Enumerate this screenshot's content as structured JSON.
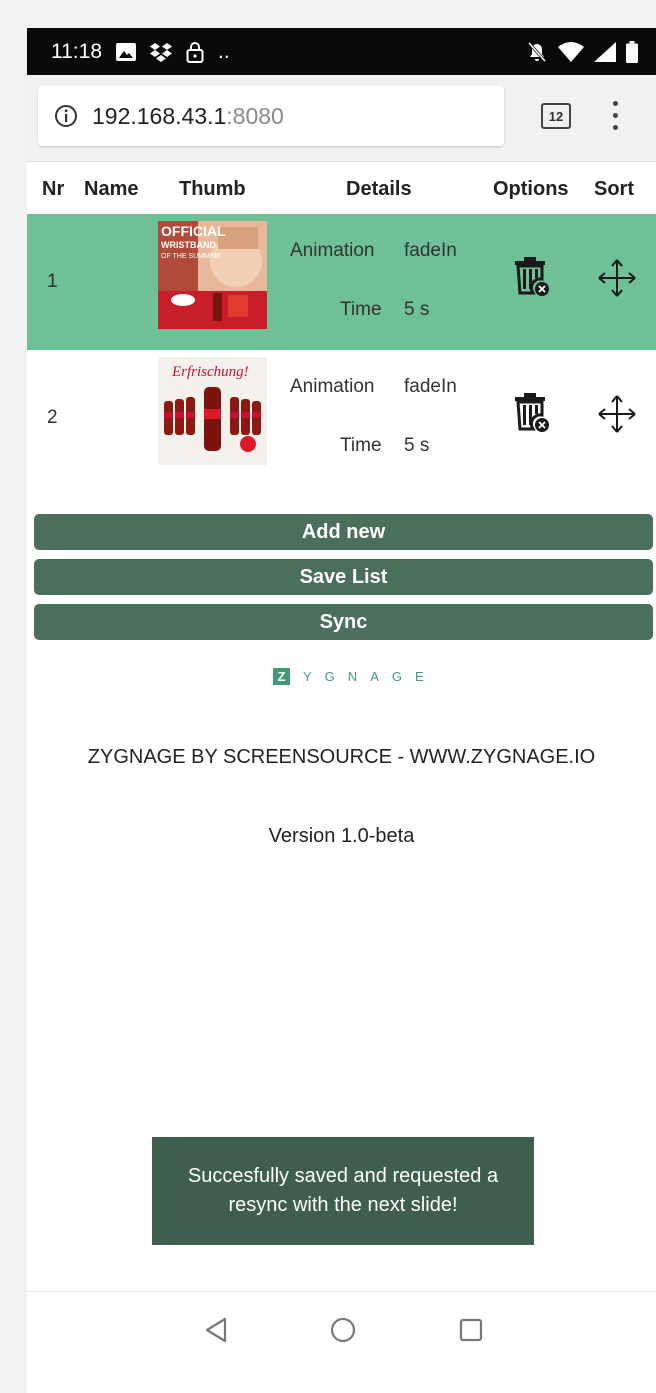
{
  "status": {
    "time": "11:18",
    "dots": ".."
  },
  "browser": {
    "host": "192.168.43.1",
    "port": ":8080",
    "tab_count": "12"
  },
  "table": {
    "headers": {
      "nr": "Nr",
      "name": "Name",
      "thumb": "Thumb",
      "details": "Details",
      "options": "Options",
      "sort": "Sort"
    },
    "rows": [
      {
        "nr": "1",
        "anim_label": "Animation",
        "anim_value": "fadeIn",
        "time_label": "Time",
        "time_value": "5 s",
        "thumb_text1": "OFFICIAL",
        "thumb_text2": "WRISTBAND",
        "thumb_text3": "OF THE SUMMER"
      },
      {
        "nr": "2",
        "anim_label": "Animation",
        "anim_value": "fadeIn",
        "time_label": "Time",
        "time_value": "5 s",
        "thumb_text1": "Erfrischung!"
      }
    ]
  },
  "actions": {
    "add_new": "Add new",
    "save_list": "Save List",
    "sync": "Sync"
  },
  "logo": {
    "letters": [
      "Z",
      "Y",
      "G",
      "N",
      "A",
      "G",
      "E"
    ]
  },
  "footer": {
    "credit": "ZYGNAGE BY SCREENSOURCE - WWW.ZYGNAGE.IO",
    "version": "Version 1.0-beta"
  },
  "toast": {
    "message": "Succesfully saved and requested a resync with the next slide!"
  },
  "colors": {
    "selected_row": "#6fbf97",
    "button": "#4a705c",
    "toast": "#3e5f4e",
    "logo": "#3f9a75"
  }
}
